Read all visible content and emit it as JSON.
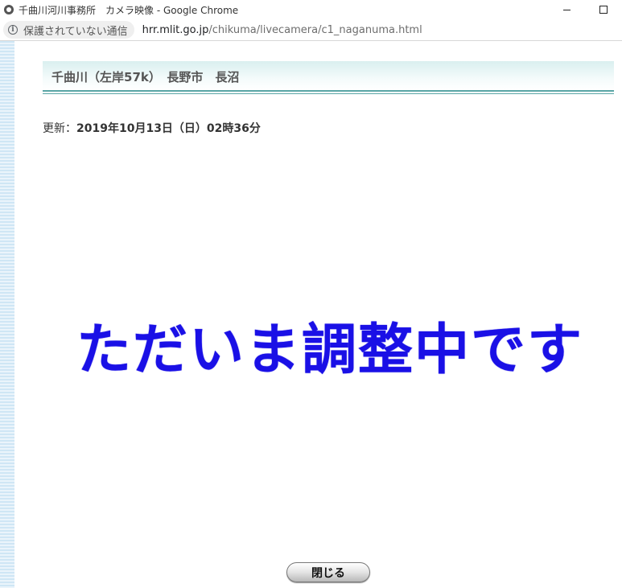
{
  "window": {
    "title": "千曲川河川事務所　カメラ映像 - Google Chrome"
  },
  "address_bar": {
    "security_label": "保護されていない通信",
    "url_host": "hrr.mlit.go.jp",
    "url_path": "/chikuma/livecamera/c1_naganuma.html"
  },
  "page": {
    "header_title": "千曲川（左岸57k）　長野市　長沼",
    "update_label": "更新：",
    "update_value": "2019年10月13日（日）02時36分",
    "maintenance_message": "ただいま調整中です",
    "close_button_label": "閉じる"
  },
  "colors": {
    "maintenance_text": "#1a10e6",
    "header_rule": "#5aa6a6"
  },
  "icons": {
    "tab_icon": "chrome-icon",
    "security_icon": "info-icon"
  }
}
